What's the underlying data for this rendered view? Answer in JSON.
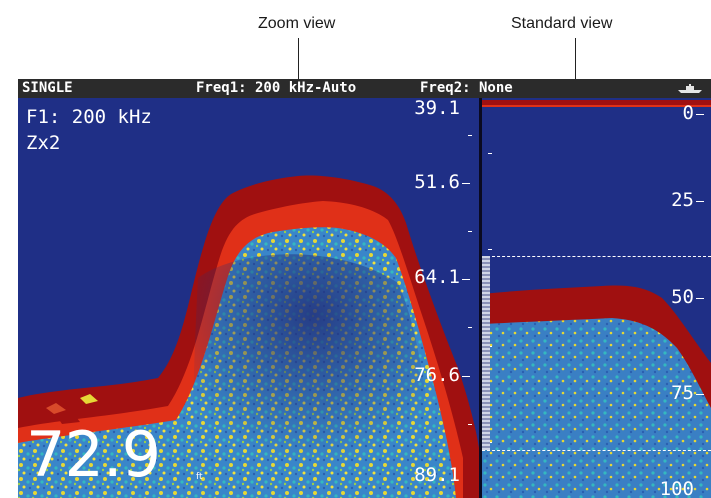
{
  "callouts": {
    "zoom_view": "Zoom view",
    "standard_view": "Standard view"
  },
  "status_bar": {
    "mode": "SINGLE",
    "freq1": "Freq1: 200 kHz-Auto",
    "freq2": "Freq2: None",
    "icon": "boat-icon"
  },
  "zoom_panel": {
    "frequency_label": "F1: 200 kHz",
    "zoom_label": "Zx2",
    "depth_value": "72.9",
    "depth_unit": "ft",
    "scale": [
      "39.1",
      "51.6",
      "64.1",
      "76.6",
      "89.1"
    ]
  },
  "standard_panel": {
    "scale": [
      "0",
      "25",
      "50",
      "75",
      "100"
    ]
  },
  "colors": {
    "water_background": "#1f2f86",
    "bottom_return": "#a01010",
    "status_bar": "#2b2b2b"
  }
}
